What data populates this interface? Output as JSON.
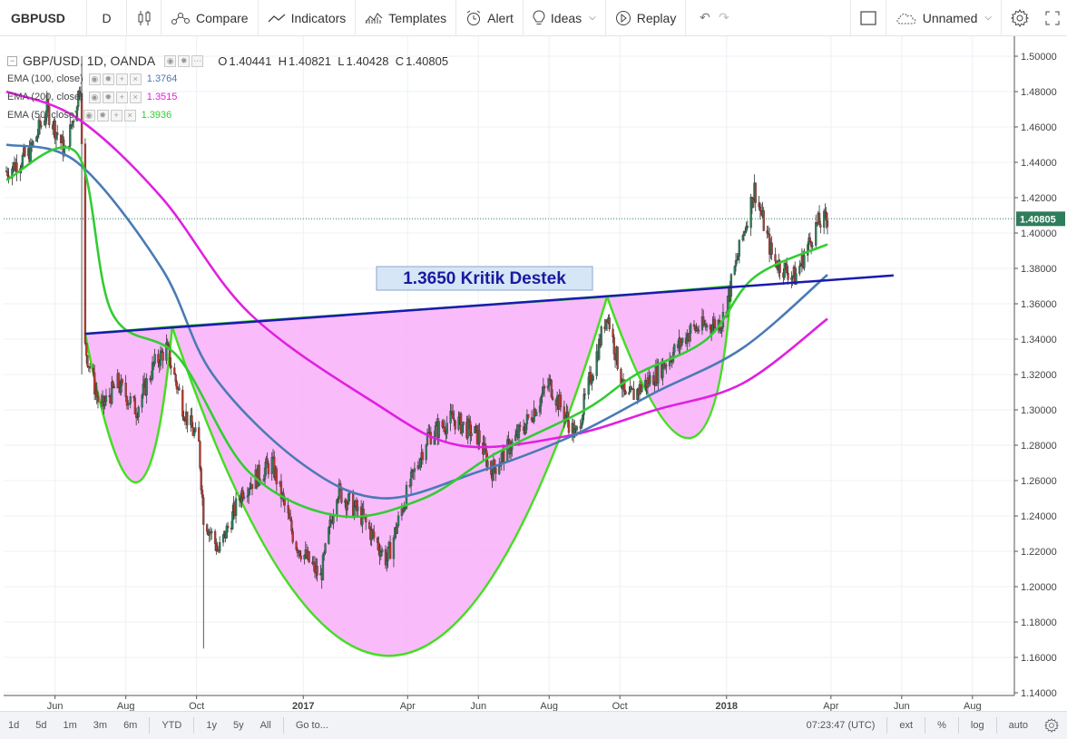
{
  "toolbar": {
    "symbol": "GBPUSD",
    "interval": "D",
    "compare": "Compare",
    "indicators": "Indicators",
    "templates": "Templates",
    "alert": "Alert",
    "ideas": "Ideas",
    "replay": "Replay",
    "layout_name": "Unnamed"
  },
  "legend": {
    "symbol_title": "GBP/USD, 1D, OANDA",
    "open_label": "O",
    "open": "1.40441",
    "high_label": "H",
    "high": "1.40821",
    "low_label": "L",
    "low": "1.40428",
    "close_label": "C",
    "close": "1.40805",
    "ema100": {
      "label": "EMA (100, close)",
      "value": "1.3764",
      "color": "#4a7bb5"
    },
    "ema200": {
      "label": "EMA (200, close)",
      "value": "1.3515",
      "color": "#e020e0"
    },
    "ema50": {
      "label": "EMA (50, close)",
      "value": "1.3936",
      "color": "#33cc33"
    }
  },
  "annotation": {
    "text": "1.3650 Kritik Destek",
    "color": "#1a1aa0"
  },
  "last_price_label": "1.40805",
  "bottom": {
    "ranges": [
      "1d",
      "5d",
      "1m",
      "3m",
      "6m",
      "YTD",
      "1y",
      "5y",
      "All"
    ],
    "goto": "Go to...",
    "clock": "07:23:47 (UTC)",
    "ext": "ext",
    "percent": "%",
    "log": "log",
    "auto": "auto"
  },
  "colors": {
    "up": "#2e7d5b",
    "down": "#b9382f",
    "pattern_fill": "#f9aff9",
    "pattern_stroke": "#44dd22",
    "trendline": "#1a1ab0"
  },
  "chart_data": {
    "type": "candlestick",
    "symbol": "GBP/USD",
    "interval": "1D",
    "ylim": [
      1.14,
      1.5
    ],
    "y_ticks": [
      "1.50000",
      "1.48000",
      "1.46000",
      "1.44000",
      "1.42000",
      "1.40000",
      "1.38000",
      "1.36000",
      "1.34000",
      "1.32000",
      "1.30000",
      "1.28000",
      "1.26000",
      "1.24000",
      "1.22000",
      "1.20000",
      "1.18000",
      "1.16000",
      "1.14000"
    ],
    "x_ticks": [
      "Jun",
      "Aug",
      "Oct",
      "2017",
      "Apr",
      "Jun",
      "Aug",
      "Oct",
      "2018",
      "Apr",
      "Jun",
      "Aug"
    ],
    "close_path": [
      [
        "2016-04-20",
        1.435
      ],
      [
        "2016-05-10",
        1.445
      ],
      [
        "2016-05-25",
        1.47
      ],
      [
        "2016-06-10",
        1.445
      ],
      [
        "2016-06-23",
        1.485
      ],
      [
        "2016-06-27",
        1.335
      ],
      [
        "2016-07-10",
        1.3
      ],
      [
        "2016-07-25",
        1.315
      ],
      [
        "2016-08-10",
        1.3
      ],
      [
        "2016-08-25",
        1.325
      ],
      [
        "2016-09-05",
        1.335
      ],
      [
        "2016-09-20",
        1.3
      ],
      [
        "2016-10-03",
        1.28
      ],
      [
        "2016-10-07",
        1.24
      ],
      [
        "2016-10-20",
        1.22
      ],
      [
        "2016-11-10",
        1.255
      ],
      [
        "2016-12-05",
        1.27
      ],
      [
        "2016-12-25",
        1.225
      ],
      [
        "2017-01-16",
        1.205
      ],
      [
        "2017-01-30",
        1.255
      ],
      [
        "2017-02-20",
        1.24
      ],
      [
        "2017-03-14",
        1.215
      ],
      [
        "2017-03-30",
        1.25
      ],
      [
        "2017-04-18",
        1.285
      ],
      [
        "2017-05-10",
        1.295
      ],
      [
        "2017-06-01",
        1.285
      ],
      [
        "2017-06-12",
        1.265
      ],
      [
        "2017-07-10",
        1.29
      ],
      [
        "2017-08-01",
        1.315
      ],
      [
        "2017-08-24",
        1.285
      ],
      [
        "2017-09-20",
        1.355
      ],
      [
        "2017-10-06",
        1.305
      ],
      [
        "2017-11-01",
        1.32
      ],
      [
        "2017-12-01",
        1.345
      ],
      [
        "2017-12-28",
        1.35
      ],
      [
        "2018-01-25",
        1.425
      ],
      [
        "2018-02-10",
        1.385
      ],
      [
        "2018-03-01",
        1.375
      ],
      [
        "2018-03-20",
        1.405
      ],
      [
        "2018-03-29",
        1.408
      ]
    ],
    "ema50_path": [
      [
        "2016-04-20",
        1.43
      ],
      [
        "2016-06-20",
        1.445
      ],
      [
        "2016-07-20",
        1.355
      ],
      [
        "2016-09-15",
        1.33
      ],
      [
        "2016-11-15",
        1.265
      ],
      [
        "2017-02-01",
        1.24
      ],
      [
        "2017-04-15",
        1.25
      ],
      [
        "2017-06-15",
        1.275
      ],
      [
        "2017-09-01",
        1.3
      ],
      [
        "2017-10-15",
        1.32
      ],
      [
        "2017-12-15",
        1.34
      ],
      [
        "2018-01-25",
        1.375
      ],
      [
        "2018-03-29",
        1.3936
      ]
    ],
    "ema100_path": [
      [
        "2016-04-20",
        1.45
      ],
      [
        "2016-06-20",
        1.44
      ],
      [
        "2016-09-01",
        1.38
      ],
      [
        "2016-10-15",
        1.32
      ],
      [
        "2016-12-30",
        1.27
      ],
      [
        "2017-03-10",
        1.25
      ],
      [
        "2017-06-01",
        1.265
      ],
      [
        "2017-08-20",
        1.285
      ],
      [
        "2017-11-01",
        1.31
      ],
      [
        "2018-01-15",
        1.335
      ],
      [
        "2018-03-29",
        1.3764
      ]
    ],
    "ema200_path": [
      [
        "2016-04-20",
        1.48
      ],
      [
        "2016-06-20",
        1.465
      ],
      [
        "2016-09-01",
        1.42
      ],
      [
        "2016-11-15",
        1.355
      ],
      [
        "2017-03-01",
        1.305
      ],
      [
        "2017-05-15",
        1.28
      ],
      [
        "2017-08-15",
        1.285
      ],
      [
        "2017-11-01",
        1.3
      ],
      [
        "2018-01-15",
        1.315
      ],
      [
        "2018-03-29",
        1.3515
      ]
    ],
    "trendline": {
      "from": [
        "2016-06-27",
        1.343
      ],
      "to": [
        "2018-05-25",
        1.376
      ]
    },
    "patterns": {
      "cup_left": {
        "left": [
          "2016-06-27",
          1.343
        ],
        "bottom": [
          "2016-08-10",
          1.259
        ],
        "right": [
          "2016-09-10",
          1.347
        ]
      },
      "cup_main": {
        "left": [
          "2016-09-10",
          1.347
        ],
        "bottom": [
          "2017-03-20",
          1.161
        ],
        "right": [
          "2017-09-20",
          1.364
        ]
      },
      "cup_right": {
        "left": [
          "2017-09-20",
          1.364
        ],
        "bottom": [
          "2017-11-30",
          1.284
        ],
        "right": [
          "2018-01-05",
          1.37
        ]
      }
    },
    "last_price": 1.40805,
    "grid": true
  }
}
